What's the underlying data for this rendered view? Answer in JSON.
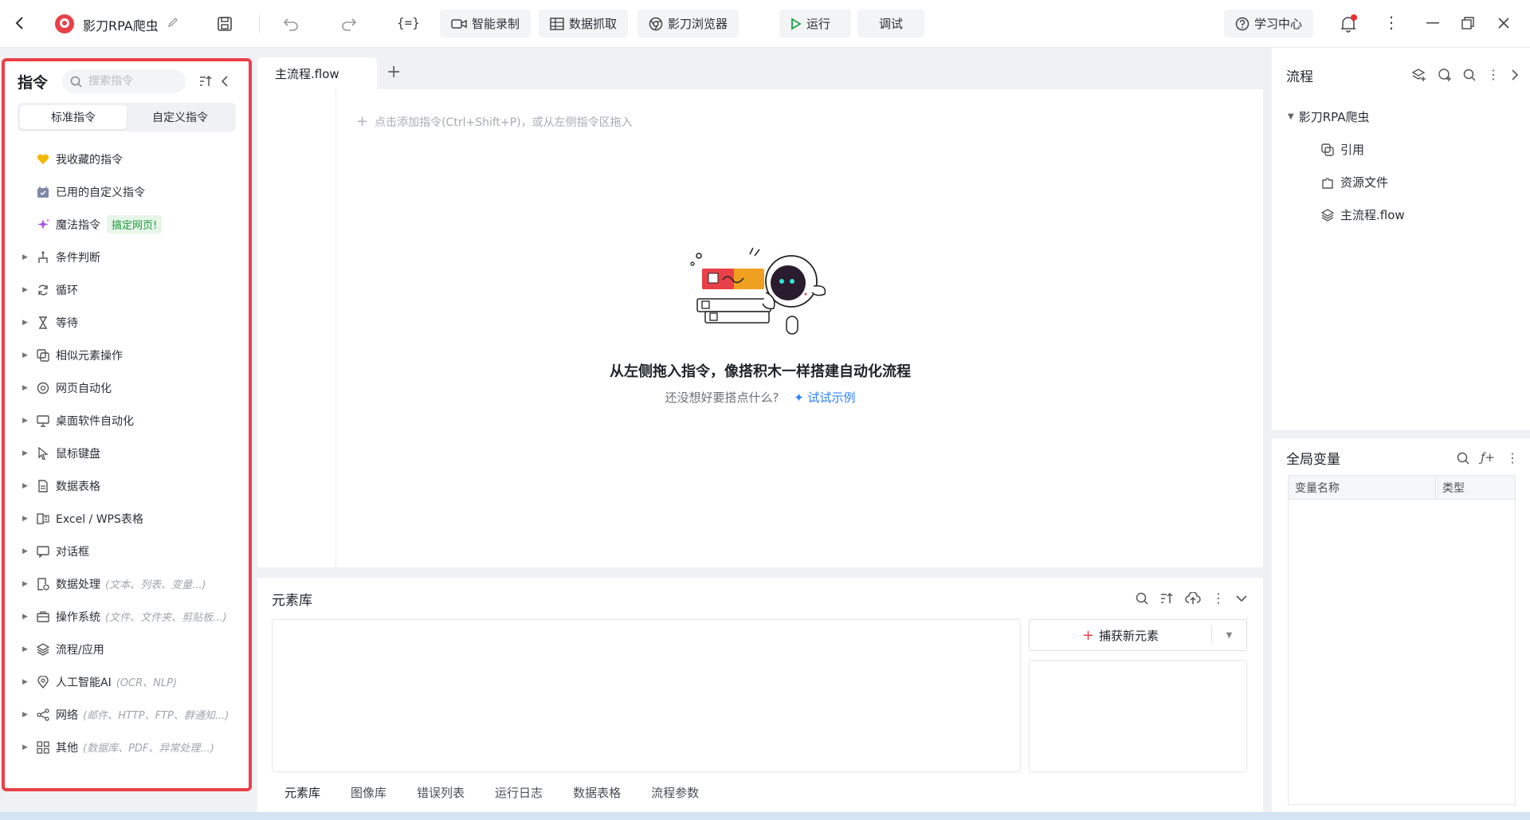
{
  "app": {
    "title": "影刀RPA爬虫",
    "accent": "#e94048"
  },
  "toolbar": {
    "record": "智能录制",
    "scrape": "数据抓取",
    "browser": "影刀浏览器",
    "run": "运行",
    "debug": "调试",
    "learn": "学习中心"
  },
  "commands": {
    "title": "指令",
    "search_placeholder": "搜索指令",
    "tabs": [
      "标准指令",
      "自定义指令"
    ],
    "favorites": "我收藏的指令",
    "used_custom": "已用的自定义指令",
    "magic": "魔法指令",
    "magic_badge": "搞定网页!",
    "groups": [
      {
        "label": "条件判断",
        "hint": "",
        "icon": "branch-icon"
      },
      {
        "label": "循环",
        "hint": "",
        "icon": "loop-icon"
      },
      {
        "label": "等待",
        "hint": "",
        "icon": "hourglass-icon"
      },
      {
        "label": "相似元素操作",
        "hint": "",
        "icon": "copy-icon"
      },
      {
        "label": "网页自动化",
        "hint": "",
        "icon": "browser-icon"
      },
      {
        "label": "桌面软件自动化",
        "hint": "",
        "icon": "monitor-icon"
      },
      {
        "label": "鼠标键盘",
        "hint": "",
        "icon": "cursor-icon"
      },
      {
        "label": "数据表格",
        "hint": "",
        "icon": "doc-icon"
      },
      {
        "label": "Excel / WPS表格",
        "hint": "",
        "icon": "excel-icon"
      },
      {
        "label": "对话框",
        "hint": "",
        "icon": "dialog-icon"
      },
      {
        "label": "数据处理",
        "hint": "(文本、列表、变量...)",
        "icon": "data-icon"
      },
      {
        "label": "操作系统",
        "hint": "(文件、文件夹、剪贴板...)",
        "icon": "briefcase-icon"
      },
      {
        "label": "流程/应用",
        "hint": "",
        "icon": "layers-icon"
      },
      {
        "label": "人工智能AI",
        "hint": "(OCR、NLP)",
        "icon": "ai-icon"
      },
      {
        "label": "网络",
        "hint": "(邮件、HTTP、FTP、群通知...)",
        "icon": "share-icon"
      },
      {
        "label": "其他",
        "hint": "(数据库、PDF、异常处理...)",
        "icon": "grid-icon"
      }
    ]
  },
  "editor": {
    "tab": "主流程.flow",
    "add_hint": "点击添加指令(Ctrl+Shift+P)，或从左侧指令区拖入",
    "empty_title": "从左侧拖入指令，像搭积木一样搭建自动化流程",
    "empty_sub": "还没想好要搭点什么?",
    "try_example": "试试示例"
  },
  "element_lib": {
    "title": "元素库",
    "capture": "捕获新元素",
    "tabs": [
      "元素库",
      "图像库",
      "错误列表",
      "运行日志",
      "数据表格",
      "流程参数"
    ]
  },
  "flow_panel": {
    "title": "流程",
    "root": "影刀RPA爬虫",
    "children": [
      "引用",
      "资源文件",
      "主流程.flow"
    ]
  },
  "vars_panel": {
    "title": "全局变量",
    "col_name": "变量名称",
    "col_type": "类型"
  }
}
